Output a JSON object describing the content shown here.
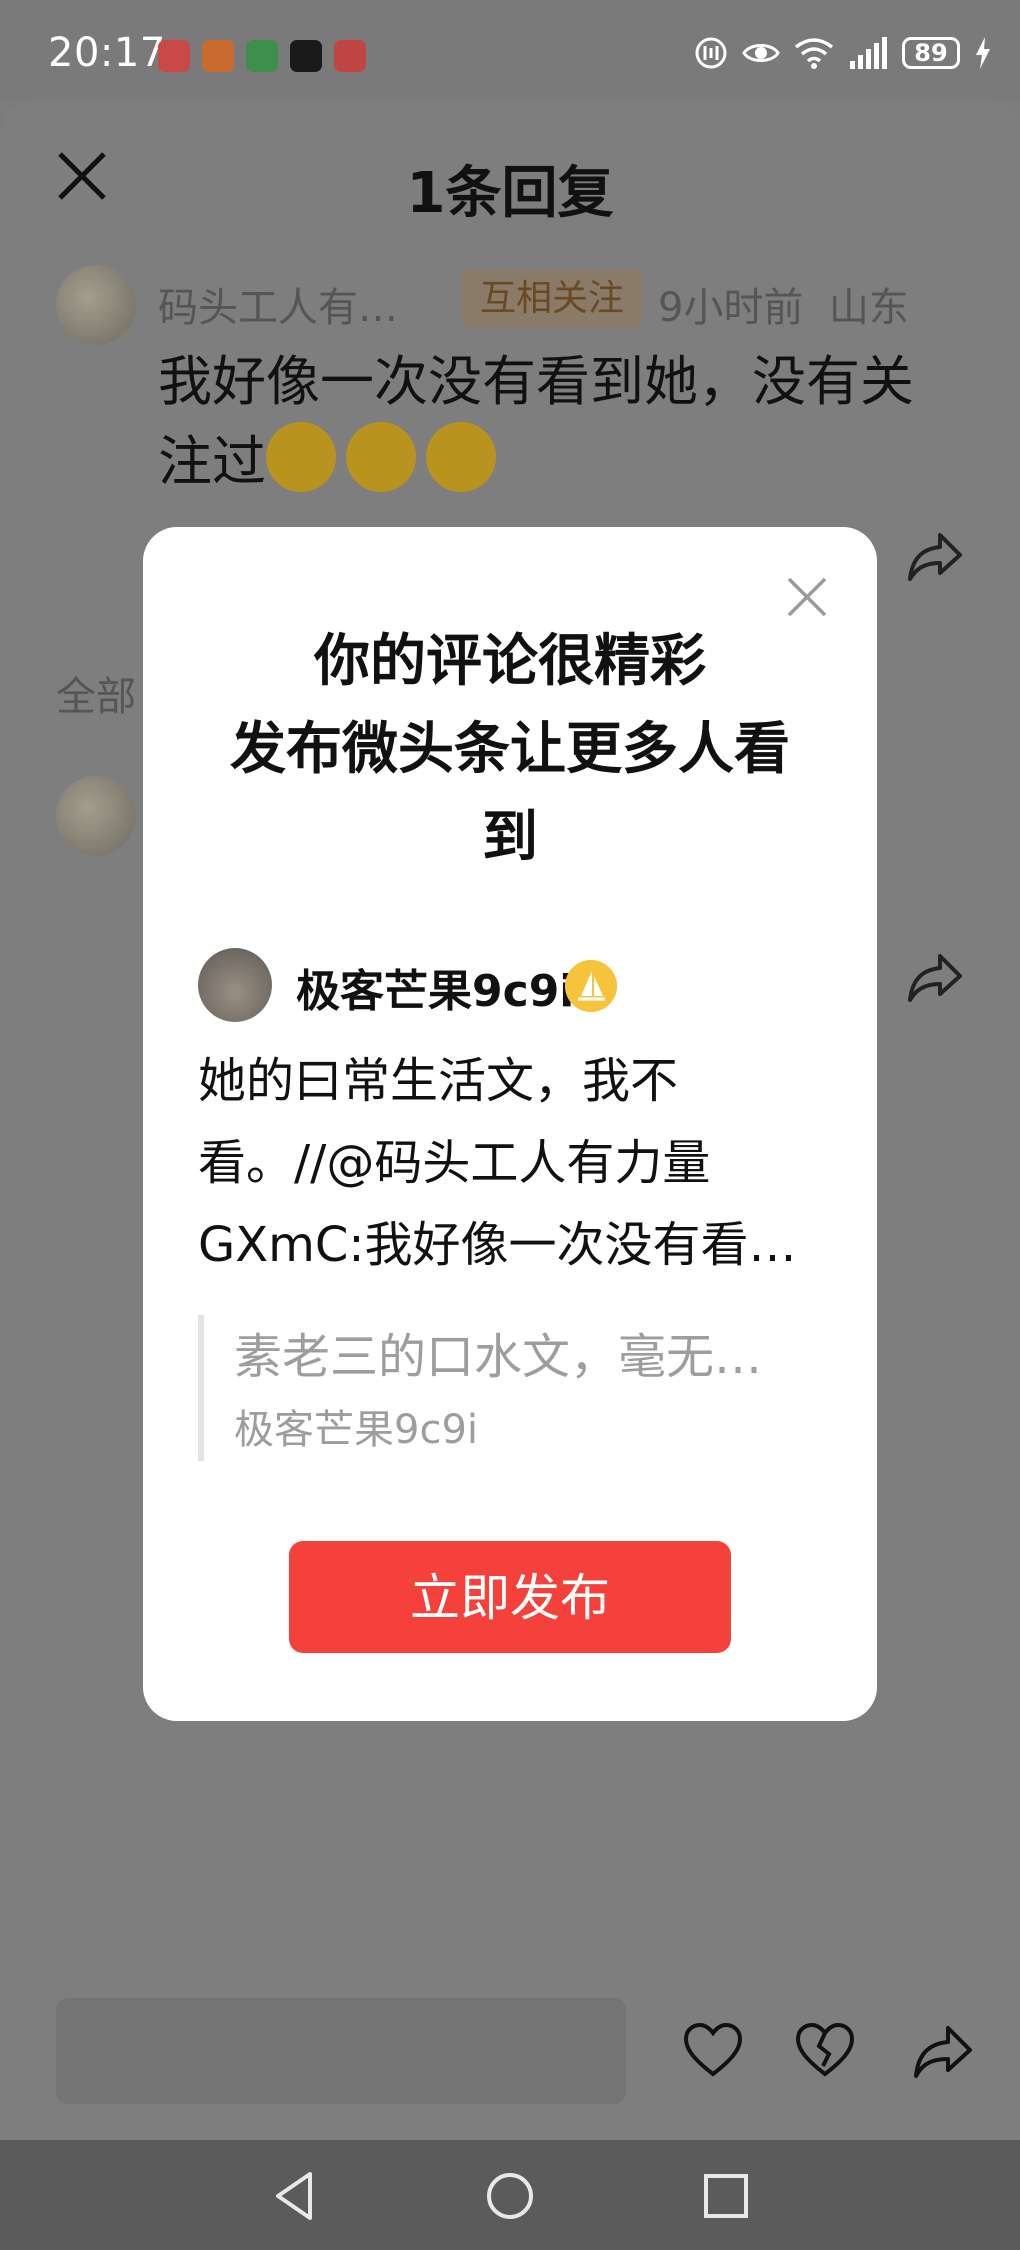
{
  "status_bar": {
    "time": "20:17",
    "battery": "89",
    "app_icons": [
      "huawei-store-icon",
      "app-orange-icon",
      "wechat-icon",
      "tiktok-icon",
      "app-red-icon"
    ]
  },
  "sheet": {
    "title": "1条回复",
    "comment": {
      "author": "码头工人有…",
      "relation_badge": "互相关注",
      "time": "9小时前",
      "location": "山东",
      "text": "我好像一次没有看到她，没有关注过"
    },
    "all_label": "全部"
  },
  "modal": {
    "title_lines": [
      "你的评论很精彩",
      "发布微头条让更多人看",
      "到"
    ],
    "post": {
      "author": "极客芒果9c9i",
      "body_lines": [
        "她的曰常生活文，我不",
        "看。//@码头工人有力量",
        "GXmC:我好像一次没有看…"
      ],
      "quote_text": "素老三的口水文，毫无…",
      "quote_author": "极客芒果9c9i"
    },
    "publish_button": "立即发布"
  },
  "colors": {
    "overlay": "#7c7c7c",
    "publish": "#f4413b",
    "badge_gold": "#f5c43c"
  }
}
